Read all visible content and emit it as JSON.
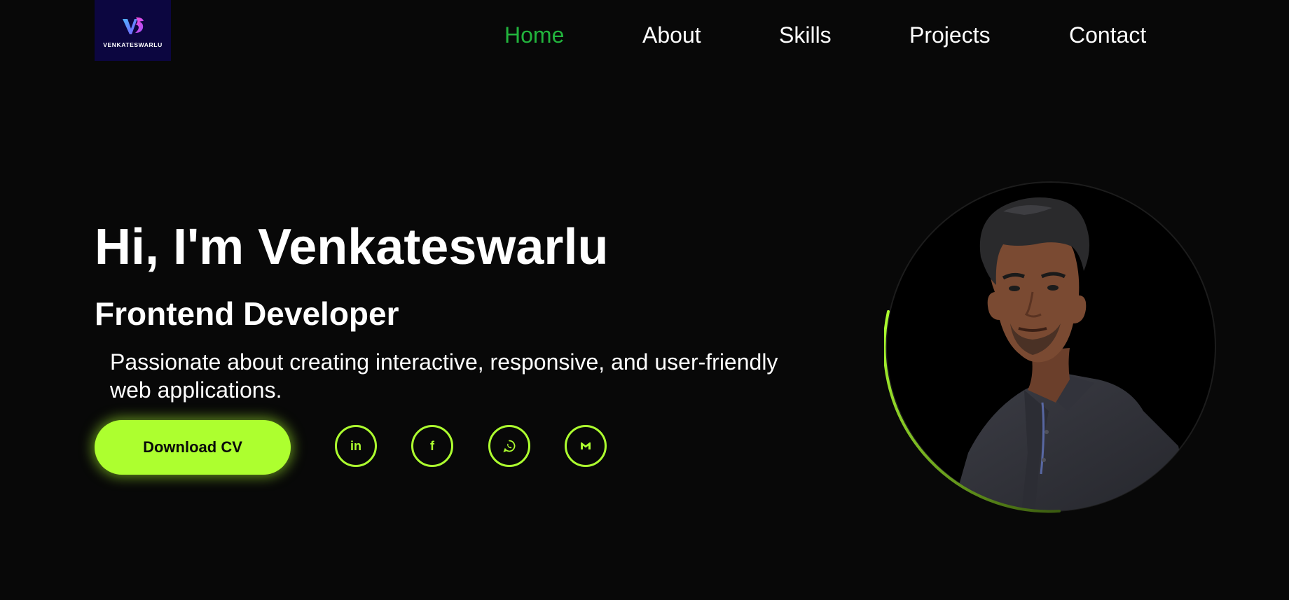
{
  "brand": {
    "logo_text": "VENKATESWARLU",
    "logo_bg": "#0c0640"
  },
  "nav": {
    "items": [
      {
        "label": "Home",
        "active": true
      },
      {
        "label": "About",
        "active": false
      },
      {
        "label": "Skills",
        "active": false
      },
      {
        "label": "Projects",
        "active": false
      },
      {
        "label": "Contact",
        "active": false
      }
    ],
    "active_color": "#22b43d"
  },
  "hero": {
    "title": "Hi, I'm Venkateswarlu",
    "role": "Frontend Developer",
    "description": "Passionate about creating interactive, responsive, and user-friendly web applications."
  },
  "cta": {
    "download_label": "Download CV"
  },
  "social": [
    {
      "name": "linkedin-icon",
      "glyph": "in"
    },
    {
      "name": "facebook-icon",
      "glyph": "f"
    },
    {
      "name": "whatsapp-icon",
      "glyph": ""
    },
    {
      "name": "gmail-icon",
      "glyph": ""
    }
  ],
  "colors": {
    "background": "#080808",
    "accent": "#adff2f",
    "text": "#ffffff"
  }
}
